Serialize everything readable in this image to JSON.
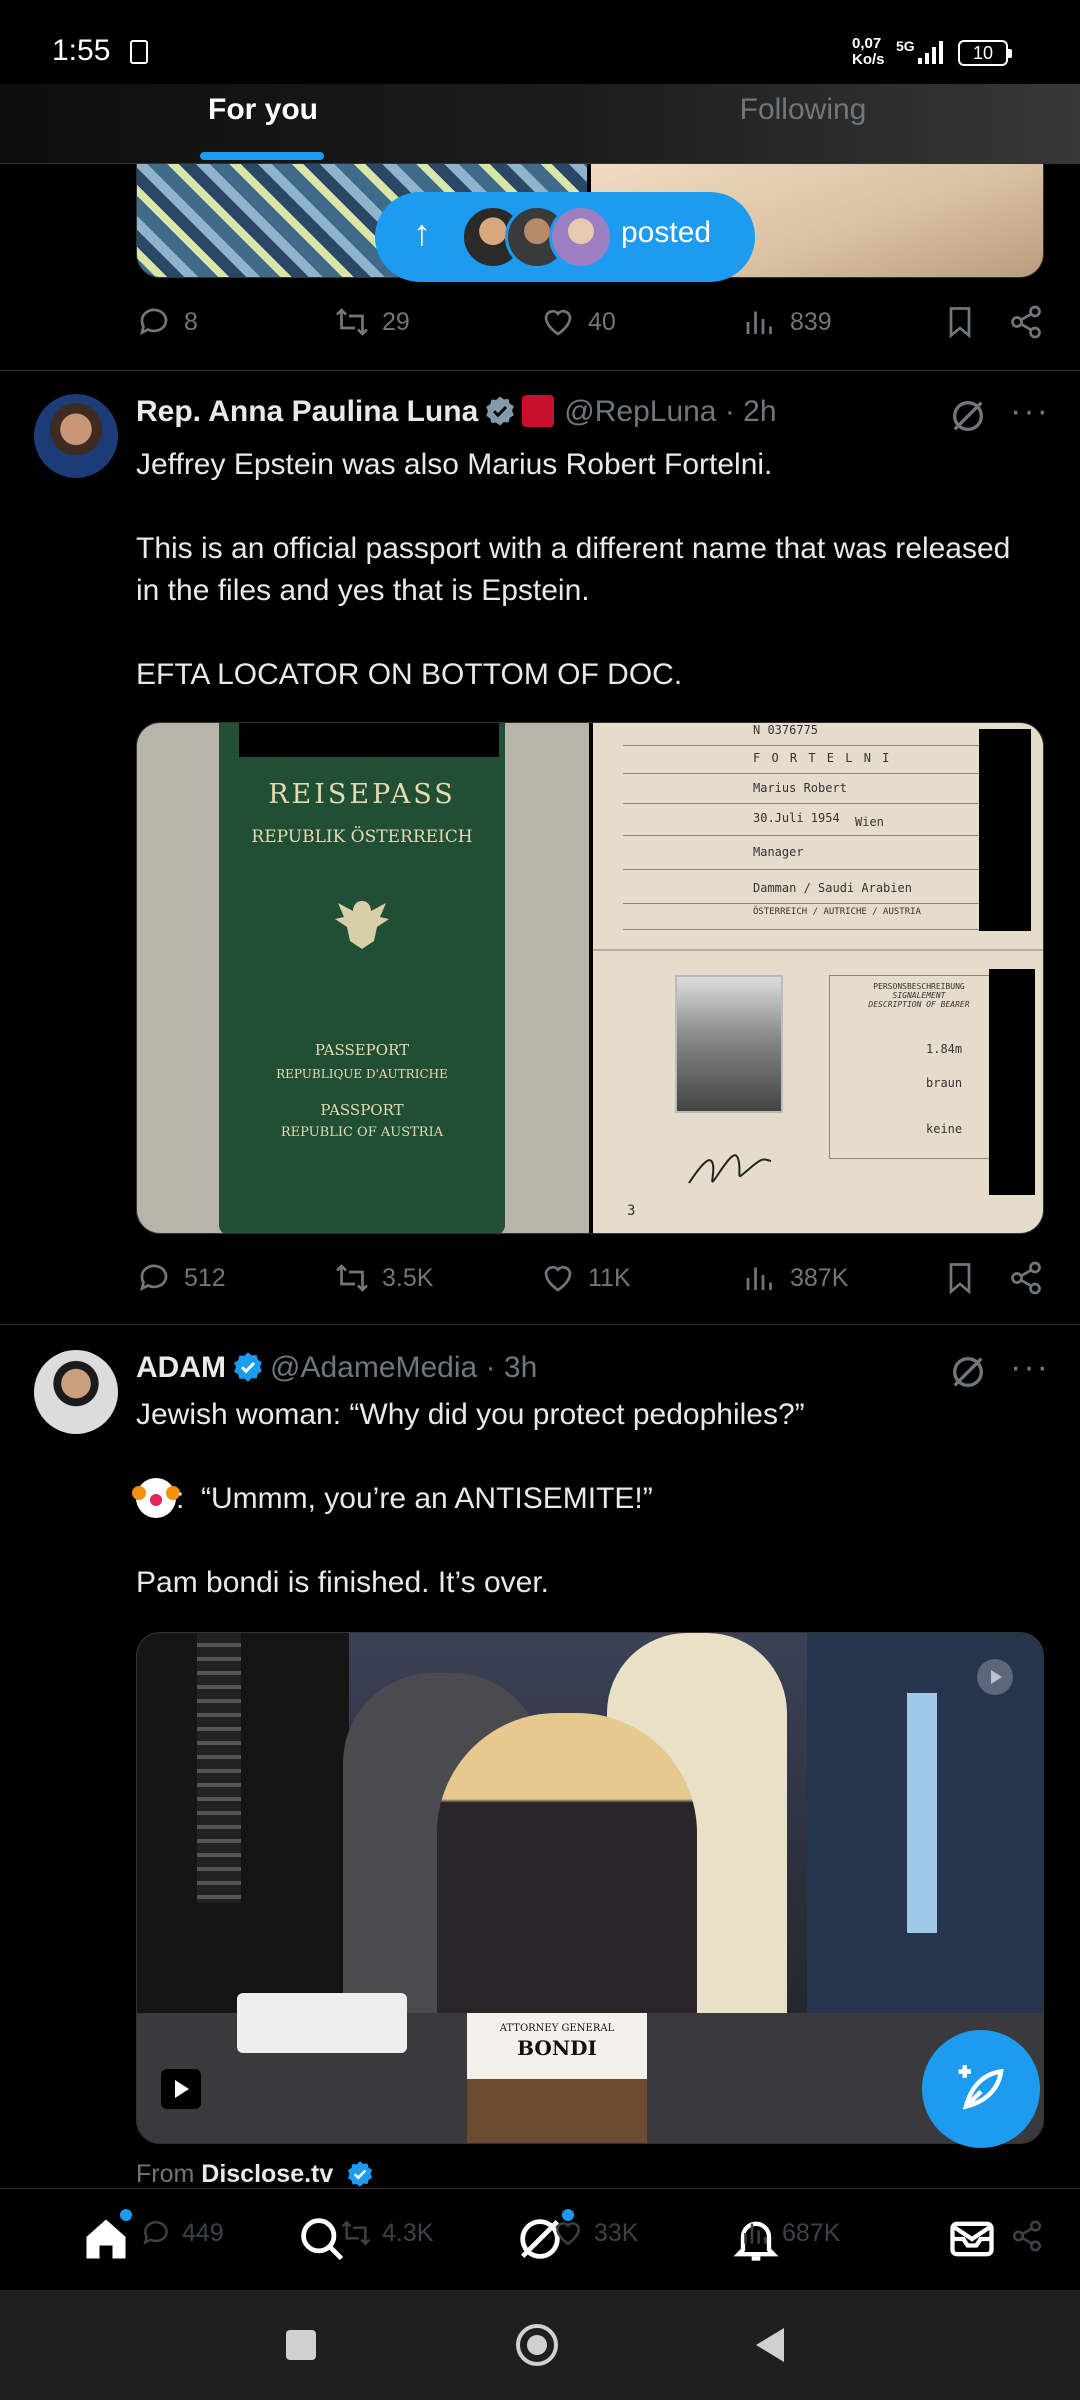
{
  "status_bar": {
    "time": "1:55",
    "speed_value": "0,07",
    "speed_unit": "Ko/s",
    "network": "5G",
    "battery": "10"
  },
  "tabs": [
    {
      "label": "For you",
      "active": true
    },
    {
      "label": "Following",
      "active": false
    }
  ],
  "posted_pill": {
    "label": "posted"
  },
  "post0": {
    "replies": "8",
    "reposts": "29",
    "likes": "40",
    "views": "839"
  },
  "post1": {
    "name": "Rep. Anna Paulina Luna",
    "handle": "@RepLuna",
    "time": "· 2h",
    "text": "Jeffrey Epstein was also Marius Robert Fortelni.\n\nThis is an official passport with a different name that was released in the files and yes that is Epstein.\n\nEFTA LOCATOR ON BOTTOM OF DOC.",
    "passport_cover": {
      "title": "REISEPASS",
      "subtitle": "REPUBLIK ÖSTERREICH",
      "fr_title": "PASSEPORT",
      "fr_sub": "REPUBLIQUE D'AUTRICHE",
      "en_title": "PASSPORT",
      "en_sub": "REPUBLIC OF AUSTRIA"
    },
    "passport_page": {
      "number": "N 0376775",
      "surname": "F O R T E L N I",
      "given": "Marius Robert",
      "dob": "30.Juli 1954",
      "pob": "Wien",
      "profession": "Manager",
      "residence": "Damman / Saudi Arabien",
      "nationality": "ÖSTERREICH / AUTRICHE / AUSTRIA",
      "desc_title": "PERSONSBESCHREIBUNG",
      "desc_sub1": "SIGNALEMENT",
      "desc_sub2": "DESCRIPTION OF BEARER",
      "height": "1.84m",
      "eyes": "braun",
      "marks": "keine",
      "page_no": "3"
    },
    "replies": "512",
    "reposts": "3.5K",
    "likes": "11K",
    "views": "387K"
  },
  "post2": {
    "name": "ADAM",
    "handle": "@AdameMedia",
    "time": "· 3h",
    "text_line1": "Jewish woman: “Why did you protect pedophiles?”",
    "text_line2": ":  “Ummm, you’re an ANTISEMITE!”",
    "text_line3": "Pam bondi is finished. It’s over.",
    "placard_title": "ATTORNEY GENERAL",
    "placard_name": "BONDI",
    "from_label": "From",
    "from_source": "Disclose.tv"
  },
  "bottom_nav": {
    "ghost_replies": "449",
    "ghost_reposts": "4.3K",
    "ghost_likes": "33K",
    "ghost_views": "687K"
  },
  "colors": {
    "accent": "#1d9bf0",
    "muted": "#71767b",
    "divider": "#2f3336",
    "background": "#000000"
  }
}
